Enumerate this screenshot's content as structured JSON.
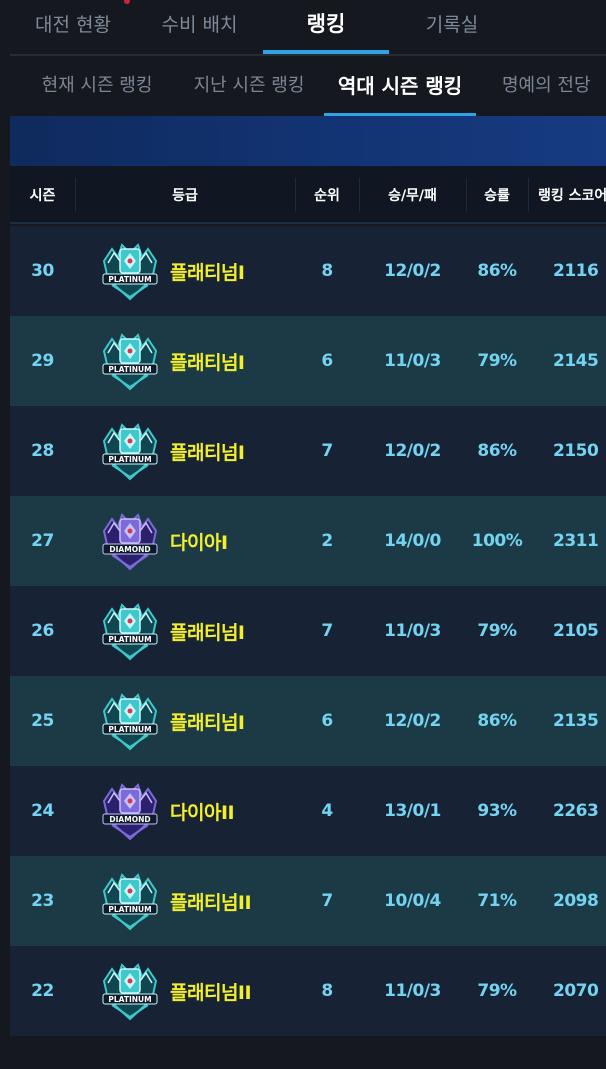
{
  "main_tabs": [
    {
      "label": "대전 현황",
      "active": false
    },
    {
      "label": "수비 배치",
      "active": false
    },
    {
      "label": "랭킹",
      "active": true
    },
    {
      "label": "기록실",
      "active": false
    }
  ],
  "sub_tabs": [
    {
      "label": "현재 시즌 랭킹",
      "active": false
    },
    {
      "label": "지난 시즌 랭킹",
      "active": false
    },
    {
      "label": "역대 시즌 랭킹",
      "active": true
    },
    {
      "label": "명예의 전당",
      "active": false
    }
  ],
  "table": {
    "headers": {
      "season": "시즌",
      "grade": "등급",
      "rank": "순위",
      "record": "승/무/패",
      "win_rate": "승률",
      "score": "랭킹 스코어"
    },
    "rows": [
      {
        "season": "30",
        "grade": "플래티넘I",
        "emblem": "platinum-emblem-icon",
        "tier": "platinum",
        "rank": "8",
        "record": "12/0/2",
        "win_rate": "86%",
        "score": "2116"
      },
      {
        "season": "29",
        "grade": "플래티넘I",
        "emblem": "platinum-emblem-icon",
        "tier": "platinum",
        "rank": "6",
        "record": "11/0/3",
        "win_rate": "79%",
        "score": "2145"
      },
      {
        "season": "28",
        "grade": "플래티넘I",
        "emblem": "platinum-emblem-icon",
        "tier": "platinum",
        "rank": "7",
        "record": "12/0/2",
        "win_rate": "86%",
        "score": "2150"
      },
      {
        "season": "27",
        "grade": "다이아I",
        "emblem": "diamond-emblem-icon",
        "tier": "diamond",
        "rank": "2",
        "record": "14/0/0",
        "win_rate": "100%",
        "score": "2311"
      },
      {
        "season": "26",
        "grade": "플래티넘I",
        "emblem": "platinum-emblem-icon",
        "tier": "platinum",
        "rank": "7",
        "record": "11/0/3",
        "win_rate": "79%",
        "score": "2105"
      },
      {
        "season": "25",
        "grade": "플래티넘I",
        "emblem": "platinum-emblem-icon",
        "tier": "platinum",
        "rank": "6",
        "record": "12/0/2",
        "win_rate": "86%",
        "score": "2135"
      },
      {
        "season": "24",
        "grade": "다이아II",
        "emblem": "diamond-emblem-icon",
        "tier": "diamond",
        "rank": "4",
        "record": "13/0/1",
        "win_rate": "93%",
        "score": "2263"
      },
      {
        "season": "23",
        "grade": "플래티넘II",
        "emblem": "platinum-emblem-icon",
        "tier": "platinum",
        "rank": "7",
        "record": "10/0/4",
        "win_rate": "71%",
        "score": "2098"
      },
      {
        "season": "22",
        "grade": "플래티넘II",
        "emblem": "platinum-emblem-icon",
        "tier": "platinum",
        "rank": "8",
        "record": "11/0/3",
        "win_rate": "79%",
        "score": "2070"
      }
    ]
  },
  "emblem_text": {
    "platinum": "PLATINUM",
    "diamond": "DIAMOND"
  },
  "colors": {
    "accent": "#2fa3e4",
    "grade_text": "#f3ef2c",
    "cell_text": "#74d3f0",
    "row_odd": "#172234",
    "row_even": "#1b3a45",
    "platinum": "#3fc7c9",
    "diamond": "#7b6bd8"
  }
}
